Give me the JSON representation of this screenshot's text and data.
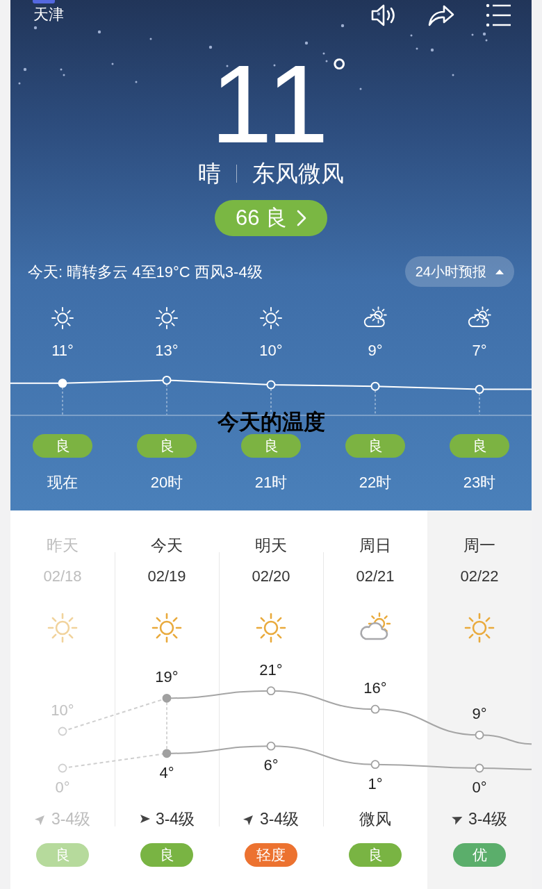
{
  "city": "天津",
  "current": {
    "temperature": "11",
    "degree": "°",
    "condition": "晴",
    "wind": "东风微风",
    "aqi": {
      "value": "66",
      "label": "良",
      "color": "#7ab743"
    }
  },
  "summary": {
    "text": "今天: 晴转多云 4至19°C 西风3-4级",
    "forecast_button": {
      "label": "24小时预报",
      "expanded": true
    }
  },
  "hourly": [
    {
      "kind": "sunny",
      "temperature": "11°",
      "aqi": "良",
      "time": "现在",
      "current": true
    },
    {
      "kind": "sunny",
      "temperature": "13°",
      "aqi": "良",
      "time": "20时",
      "current": false
    },
    {
      "kind": "sunny",
      "temperature": "10°",
      "aqi": "良",
      "time": "21时",
      "current": false
    },
    {
      "kind": "partly-cloudy",
      "temperature": "9°",
      "aqi": "良",
      "time": "22时",
      "current": false
    },
    {
      "kind": "partly-cloudy",
      "temperature": "7°",
      "aqi": "良",
      "time": "23时",
      "current": false
    }
  ],
  "overlay_caption": "今天的温度",
  "daily": [
    {
      "day": "昨天",
      "date": "02/18",
      "kind": "sunny",
      "high": "10°",
      "low": "0°",
      "wind": {
        "kind": "northeast",
        "text": "3-4级"
      },
      "aqi": "良",
      "color": "#b6da9c",
      "past": true,
      "today": false,
      "selected": false
    },
    {
      "day": "今天",
      "date": "02/19",
      "kind": "sunny",
      "high": "19°",
      "low": "4°",
      "wind": {
        "kind": "east",
        "text": "3-4级"
      },
      "aqi": "良",
      "color": "#79b443",
      "past": false,
      "today": true,
      "selected": false
    },
    {
      "day": "明天",
      "date": "02/20",
      "kind": "sunny",
      "high": "21°",
      "low": "6°",
      "wind": {
        "kind": "northeast",
        "text": "3-4级"
      },
      "aqi": "轻度",
      "color": "#ec7230",
      "past": false,
      "today": false,
      "selected": false
    },
    {
      "day": "周日",
      "date": "02/21",
      "kind": "partly-cloudy",
      "high": "16°",
      "low": "1°",
      "wind": {
        "kind": "none",
        "text": "微风"
      },
      "aqi": "良",
      "color": "#79b443",
      "past": false,
      "today": false,
      "selected": false
    },
    {
      "day": "周一",
      "date": "02/22",
      "kind": "sunny",
      "high": "9°",
      "low": "0°",
      "wind": {
        "kind": "east-northeast",
        "text": "3-4级"
      },
      "aqi": "优",
      "color": "#5bae6b",
      "past": false,
      "today": false,
      "selected": true
    }
  ]
}
